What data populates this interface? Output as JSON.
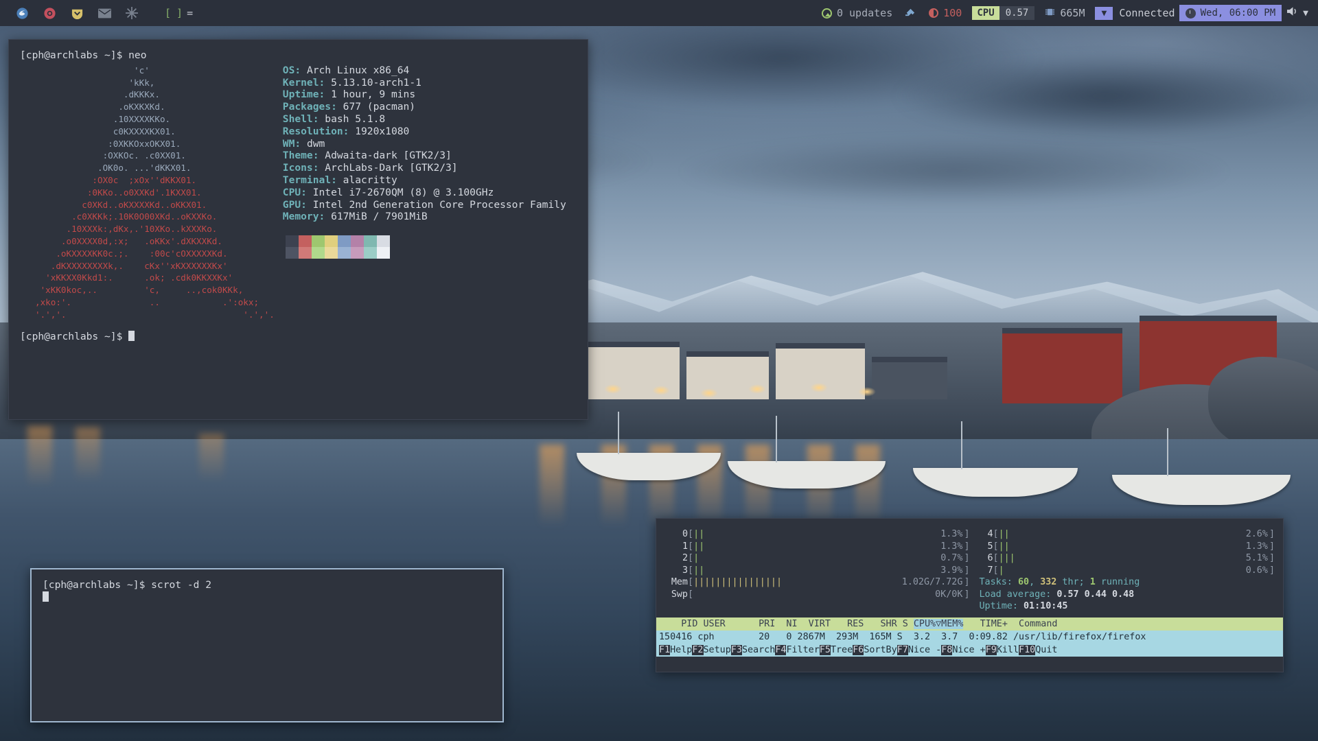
{
  "bar": {
    "launchers": [
      {
        "name": "firefox-icon",
        "glyph": "●"
      },
      {
        "name": "chromium-icon",
        "glyph": "●"
      },
      {
        "name": "archlabs-icon",
        "glyph": "●"
      },
      {
        "name": "mail-icon",
        "glyph": "✉"
      },
      {
        "name": "settings-icon",
        "glyph": "✹"
      }
    ],
    "tags": [
      "[",
      "]",
      "="
    ],
    "window_title": "",
    "updates": {
      "count_label": "0 updates",
      "icon": "arrow-up-circle-icon"
    },
    "volume": {
      "icon": "plug-icon"
    },
    "battery": {
      "icon": "battery-icon",
      "value": "100"
    },
    "cpu": {
      "label": "CPU",
      "value": "0.57"
    },
    "memory": {
      "icon": "chip-icon",
      "value": "665M"
    },
    "network": {
      "icon": "caret-down-icon",
      "label": "Connected"
    },
    "clock": {
      "icon": "clock-icon",
      "value": "Wed, 06:00 PM"
    },
    "speaker_icon": "speaker-icon",
    "tray_caret": "caret-down-icon"
  },
  "terminal_neofetch": {
    "prompt_line": "[cph@archlabs ~]$ neo",
    "prompt_tail": "[cph@archlabs ~]$ ",
    "ascii": [
      "                   'c'",
      "                  'kKk,",
      "                 .dKKKx.",
      "                .oKXKXKd.",
      "               .10XXXXKKo.",
      "               c0KXXXXKX01.",
      "              :0XKKOxxOKX01.",
      "             :OXKOc. .c0XX01.",
      "            .OK0o. ...'dKKX01.",
      "           :OX0c  ;xOx''dKKX01.",
      "          :0KKo..o0XXKd'.1KXX01.",
      "         c0XKd..oKXXXXKd..oKKX01.",
      "       .c0XKKk;.10K0O00XKd..oKXXKo.",
      "      .10XXXk:,dKx,.'10XKo..kXXXKo.",
      "     .o0XXXX0d,:x;   .oKKx'.dXKXXKd.",
      "    .oKXXXXKK0c.;.    :00c'cOXXXXXKd.",
      "   .dKXXXXXXXXk,.    cKx''xKXXXXXXKx'",
      "  'xKKXX0Kkd1:.      .ok; .cdk0KKXXKx'",
      " 'xKK0koc,..         'c,     ..,cok0KKk,",
      ",xko:'.               ..            .':okx;",
      "'.','.                                  '.','."
    ],
    "info": [
      {
        "key": "OS",
        "value": "Arch Linux x86_64"
      },
      {
        "key": "Kernel",
        "value": "5.13.10-arch1-1"
      },
      {
        "key": "Uptime",
        "value": "1 hour, 9 mins"
      },
      {
        "key": "Packages",
        "value": "677 (pacman)"
      },
      {
        "key": "Shell",
        "value": "bash 5.1.8"
      },
      {
        "key": "Resolution",
        "value": "1920x1080"
      },
      {
        "key": "WM",
        "value": "dwm"
      },
      {
        "key": "Theme",
        "value": "Adwaita-dark [GTK2/3]"
      },
      {
        "key": "Icons",
        "value": "ArchLabs-Dark [GTK2/3]"
      },
      {
        "key": "Terminal",
        "value": "alacritty"
      },
      {
        "key": "CPU",
        "value": "Intel i7-2670QM (8) @ 3.100GHz"
      },
      {
        "key": "GPU",
        "value": "Intel 2nd Generation Core Processor Family"
      },
      {
        "key": "Memory",
        "value": "617MiB / 7901MiB"
      }
    ],
    "palette_row1": [
      "#3d4250",
      "#c4605f",
      "#9ec76f",
      "#e0cf7e",
      "#7f9bc4",
      "#b481a8",
      "#7fb8b0",
      "#d8dce3"
    ],
    "palette_row2": [
      "#4e5463",
      "#d17a78",
      "#b0d98c",
      "#ead99a",
      "#9ab3d4",
      "#c79bbb",
      "#9bcdc6",
      "#eef1f5"
    ]
  },
  "terminal_scrot": {
    "prompt_line": "[cph@archlabs ~]$ scrot -d 2"
  },
  "htop": {
    "cpu_meters_left": [
      {
        "id": "0",
        "pct": "1.3%",
        "bars": "||"
      },
      {
        "id": "1",
        "pct": "1.3%",
        "bars": "||"
      },
      {
        "id": "2",
        "pct": "0.7%",
        "bars": "|"
      },
      {
        "id": "3",
        "pct": "3.9%",
        "bars": "||"
      }
    ],
    "cpu_meters_right": [
      {
        "id": "4",
        "pct": "2.6%",
        "bars": "||"
      },
      {
        "id": "5",
        "pct": "1.3%",
        "bars": "||"
      },
      {
        "id": "6",
        "pct": "5.1%",
        "bars": "|||"
      },
      {
        "id": "7",
        "pct": "0.6%",
        "bars": "|"
      }
    ],
    "mem": {
      "label": "Mem",
      "value": "1.02G/7.72G",
      "bars": "||||||||||||||||"
    },
    "swp": {
      "label": "Swp",
      "value": "0K/0K",
      "bars": ""
    },
    "tasks_label": "Tasks: ",
    "tasks_count": "60",
    "tasks_sep": ", ",
    "threads": "332",
    "threads_label": " thr; ",
    "running": "1",
    "running_label": " running",
    "load_label": "Load average: ",
    "load": "0.57 0.44 0.48",
    "uptime_label": "Uptime: ",
    "uptime": "01:10:45",
    "columns_pre": "    PID USER      PRI  NI  VIRT   RES   SHR S ",
    "columns_sel": "CPU%▽MEM%",
    "columns_post": "   TIME+  Command",
    "row": "150416 cph        20   0 2867M  293M  165M S  3.2  3.7  0:09.82 /usr/lib/firefox/firefox",
    "fkeys": [
      {
        "key": "F1",
        "label": "Help"
      },
      {
        "key": "F2",
        "label": "Setup"
      },
      {
        "key": "F3",
        "label": "Search"
      },
      {
        "key": "F4",
        "label": "Filter"
      },
      {
        "key": "F5",
        "label": "Tree"
      },
      {
        "key": "F6",
        "label": "SortBy"
      },
      {
        "key": "F7",
        "label": "Nice -"
      },
      {
        "key": "F8",
        "label": "Nice +"
      },
      {
        "key": "F9",
        "label": "Kill"
      },
      {
        "key": "F10",
        "label": "Quit"
      }
    ]
  }
}
